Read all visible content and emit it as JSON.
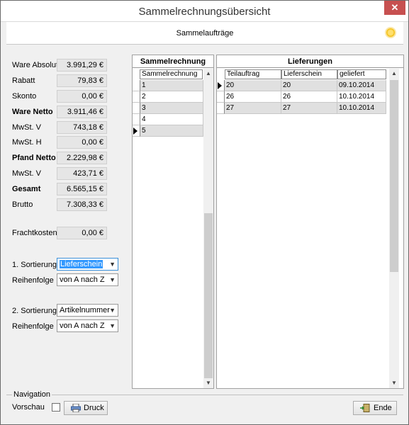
{
  "window": {
    "title": "Sammelrechnungsübersicht",
    "close_glyph": "✕"
  },
  "banner": {
    "title": "Sammelaufträge"
  },
  "summary": [
    {
      "label": "Ware Absolut",
      "value": "3.991,29 €",
      "bold": false
    },
    {
      "label": "Rabatt",
      "value": "79,83 €",
      "bold": false
    },
    {
      "label": "Skonto",
      "value": "0,00 €",
      "bold": false
    },
    {
      "label": "Ware Netto",
      "value": "3.911,46 €",
      "bold": true
    },
    {
      "label": "MwSt. V",
      "value": "743,18 €",
      "bold": false
    },
    {
      "label": "MwSt. H",
      "value": "0,00 €",
      "bold": false
    },
    {
      "label": "Pfand Netto",
      "value": "2.229,98 €",
      "bold": true
    },
    {
      "label": "MwSt. V",
      "value": "423,71 €",
      "bold": false
    },
    {
      "label": "Gesamt",
      "value": "6.565,15 €",
      "bold": true
    },
    {
      "label": "Brutto",
      "value": "7.308,33 €",
      "bold": false
    }
  ],
  "freight": {
    "label": "Frachtkosten",
    "value": "0,00 €"
  },
  "sort1": {
    "label": "1. Sortierung",
    "value": "Lieferschein",
    "order_label": "Reihenfolge",
    "order_value": "von A nach Z"
  },
  "sort2": {
    "label": "2. Sortierung",
    "value": "Artikelnummer",
    "order_label": "Reihenfolge",
    "order_value": "von A nach Z"
  },
  "sammel_panel": {
    "title": "Sammelrechnung",
    "column": "Sammelrechnung",
    "rows": [
      "1",
      "2",
      "3",
      "4",
      "5"
    ],
    "selected_index": 4
  },
  "lief_panel": {
    "title": "Lieferungen",
    "columns": [
      "Teilauftrag",
      "Lieferschein",
      "geliefert"
    ],
    "rows": [
      [
        "20",
        "20",
        "09.10.2014"
      ],
      [
        "26",
        "26",
        "10.10.2014"
      ],
      [
        "27",
        "27",
        "10.10.2014"
      ]
    ],
    "selected_index": 0
  },
  "navigation": {
    "caption": "Navigation",
    "preview_label": "Vorschau",
    "print_button": "Druck",
    "exit_button": "Ende"
  },
  "colors": {
    "row_shade": "#e0e0e0",
    "selection_blue": "#3399ff",
    "close_red": "#c75050"
  }
}
